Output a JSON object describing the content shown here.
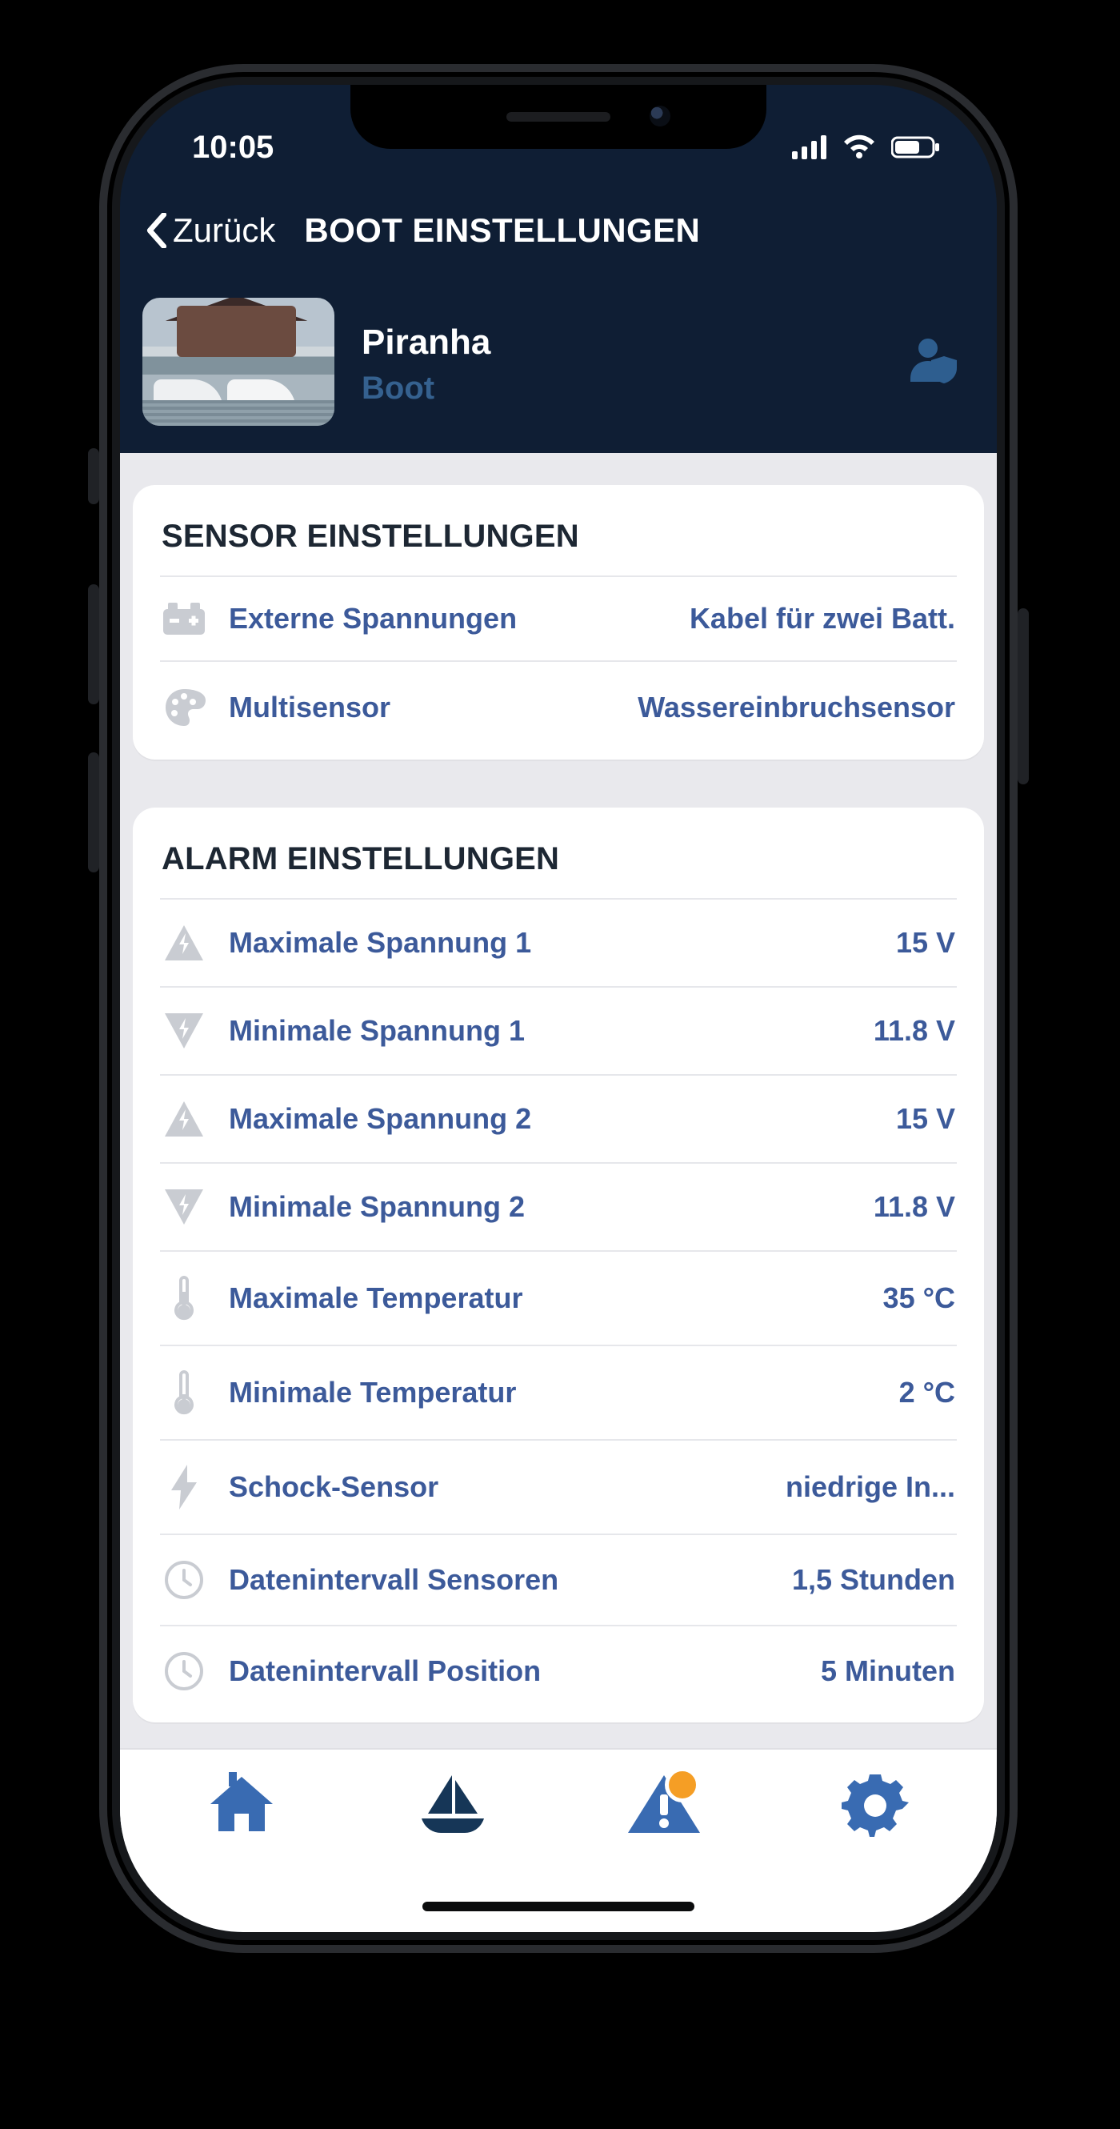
{
  "status": {
    "time": "10:05"
  },
  "nav": {
    "back": "Zurück",
    "title": "BOOT EINSTELLUNGEN"
  },
  "boat": {
    "name": "Piranha",
    "type": "Boot"
  },
  "sensor": {
    "title": "SENSOR EINSTELLUNGEN",
    "rows": [
      {
        "icon": "battery-icon",
        "label": "Externe Spannungen",
        "value": "Kabel für zwei Batt."
      },
      {
        "icon": "palette-icon",
        "label": "Multisensor",
        "value": "Wassereinbruchsensor"
      }
    ]
  },
  "alarm": {
    "title": "ALARM EINSTELLUNGEN",
    "rows": [
      {
        "icon": "bolt-up-icon",
        "label": "Maximale Spannung 1",
        "value": "15 V"
      },
      {
        "icon": "bolt-down-icon",
        "label": "Minimale Spannung 1",
        "value": "11.8 V"
      },
      {
        "icon": "bolt-up-icon",
        "label": "Maximale Spannung 2",
        "value": "15 V"
      },
      {
        "icon": "bolt-down-icon",
        "label": "Minimale Spannung 2",
        "value": "11.8 V"
      },
      {
        "icon": "thermometer-icon",
        "label": "Maximale Temperatur",
        "value": "35 °C"
      },
      {
        "icon": "thermometer-icon",
        "label": "Minimale Temperatur",
        "value": "2 °C"
      },
      {
        "icon": "bolt-icon",
        "label": "Schock-Sensor",
        "value": "niedrige In..."
      },
      {
        "icon": "clock-icon",
        "label": "Datenintervall Sensoren",
        "value": "1,5 Stunden"
      },
      {
        "icon": "clock-icon",
        "label": "Datenintervall Position",
        "value": "5 Minuten"
      }
    ]
  },
  "tabs": {
    "home": {
      "icon": "home-icon",
      "color": "#396BB2"
    },
    "boat": {
      "icon": "sailboat-icon",
      "color": "#163657"
    },
    "alerts": {
      "icon": "warning-icon",
      "color": "#396BB2",
      "badge": true
    },
    "settings": {
      "icon": "gear-icon",
      "color": "#396BB2"
    }
  }
}
